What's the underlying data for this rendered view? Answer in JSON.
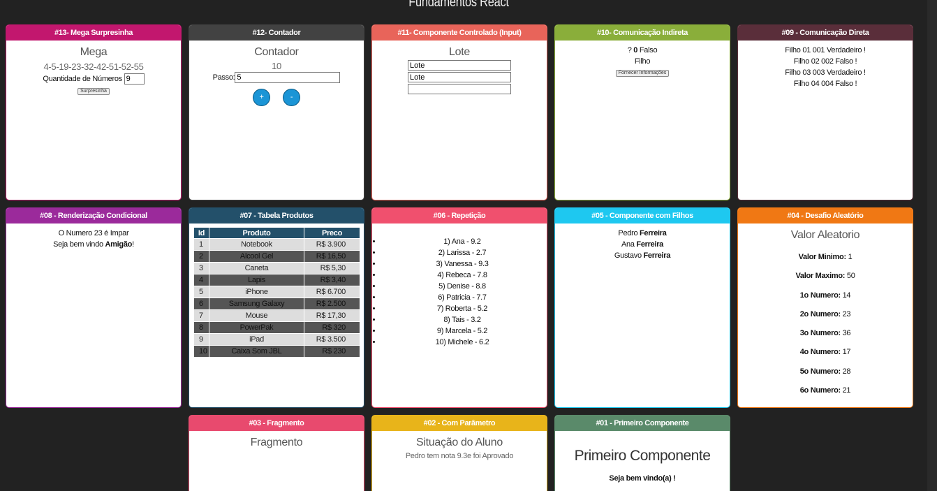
{
  "page": {
    "title": "Fundamentos React"
  },
  "cards": {
    "c13": {
      "header": "#13- Mega Surpresinha",
      "color": "#c2176e",
      "title": "Mega",
      "numbers": "4-5-19-23-32-42-51-52-55",
      "qty_label": "Quantidade de Números",
      "qty_value": "9",
      "button_label": "Surpresinha"
    },
    "c12": {
      "header": "#12- Contador",
      "color": "#424242",
      "title": "Contador",
      "value": "10",
      "step_label": "Passo:",
      "step_value": "5",
      "plus_label": "+",
      "minus_label": "-"
    },
    "c11": {
      "header": "#11- Componente Controlado (Input)",
      "color": "#e8645a",
      "title": "Lote",
      "input1": "Lote",
      "input2": "Lote",
      "input3": ""
    },
    "c10": {
      "header": "#10- Comunicação Indireta",
      "color": "#8aae3a",
      "q_prefix": "? ",
      "q_value": "0",
      "q_suffix": " Falso",
      "child_label": "Filho",
      "button_label": "Fornecer Informações"
    },
    "c09": {
      "header": "#09 - Comunicação Direta",
      "color": "#5a2e3a",
      "lines": [
        "Filho 01 001 Verdadeiro !",
        "Filho 02 002 Falso !",
        "Filho 03 003 Verdadeiro !",
        "Filho 04 004 Falso !"
      ]
    },
    "c08": {
      "header": "#08 - Renderização Condicional",
      "color": "#9b2a9b",
      "line1": "O Numero 23 é Impar",
      "line2_prefix": "Seja bem vindo ",
      "line2_bold": "Amigão",
      "line2_suffix": "!"
    },
    "c07": {
      "header": "#07 - Tabela Produtos",
      "color": "#23506a",
      "columns": [
        "Id",
        "Produto",
        "Preco"
      ],
      "rows": [
        [
          "1",
          "Notebook",
          "R$ 3.900"
        ],
        [
          "2",
          "Alcool Gel",
          "R$ 16,50"
        ],
        [
          "3",
          "Caneta",
          "R$ 5,30"
        ],
        [
          "4",
          "Lapis",
          "R$ 3,40"
        ],
        [
          "5",
          "iPhone",
          "R$ 6.700"
        ],
        [
          "6",
          "Samsung Galaxy",
          "R$ 2.500"
        ],
        [
          "7",
          "Mouse",
          "R$ 17,30"
        ],
        [
          "8",
          "PowerPak",
          "R$ 320"
        ],
        [
          "9",
          "iPad",
          "R$ 3.500"
        ],
        [
          "10",
          "Caixa Som JBL",
          "R$ 230"
        ]
      ]
    },
    "c06": {
      "header": "#06 - Repetição",
      "color": "#f0506e",
      "items": [
        "1) Ana - 9.2",
        "2) Larissa - 2.7",
        "3) Vanessa - 9.3",
        "4) Rebeca - 7.8",
        "5) Denise - 8.8",
        "6) Patricia - 7.7",
        "7) Roberta - 5.2",
        "8) Tais - 3.2",
        "9) Marcela - 5.2",
        "10) Michele - 6.2"
      ]
    },
    "c05": {
      "header": "#05 - Componente com Filhos",
      "color": "#1ec8f0",
      "children": [
        {
          "first": "Pedro ",
          "last": "Ferreira"
        },
        {
          "first": "Ana ",
          "last": "Ferreira"
        },
        {
          "first": "Gustavo ",
          "last": "Ferreira"
        }
      ]
    },
    "c04": {
      "header": "#04 - Desafio Aleatório",
      "color": "#f07814",
      "title": "Valor Aleatorio",
      "rows": [
        {
          "label": "Valor Minimo:",
          "value": " 1"
        },
        {
          "label": "Valor Maximo:",
          "value": " 50"
        },
        {
          "label": "1o Numero:",
          "value": " 14"
        },
        {
          "label": "2o Numero:",
          "value": " 23"
        },
        {
          "label": "3o Numero:",
          "value": " 36"
        },
        {
          "label": "4o Numero:",
          "value": " 17"
        },
        {
          "label": "5o Numero:",
          "value": " 28"
        },
        {
          "label": "6o Numero:",
          "value": " 21"
        }
      ]
    },
    "c03": {
      "header": "#03 - Fragmento",
      "color": "#e84a6e",
      "title": "Fragmento"
    },
    "c02": {
      "header": "#02 - Com Parâmetro",
      "color": "#e8b41a",
      "title": "Situação do Aluno",
      "text": "Pedro tem nota 9.3e foi Aprovado"
    },
    "c01": {
      "header": "#01 - Primeiro Componente",
      "color": "#5a8a6a",
      "title": "Primeiro Componente",
      "text": "Seja bem vindo(a) !"
    }
  }
}
